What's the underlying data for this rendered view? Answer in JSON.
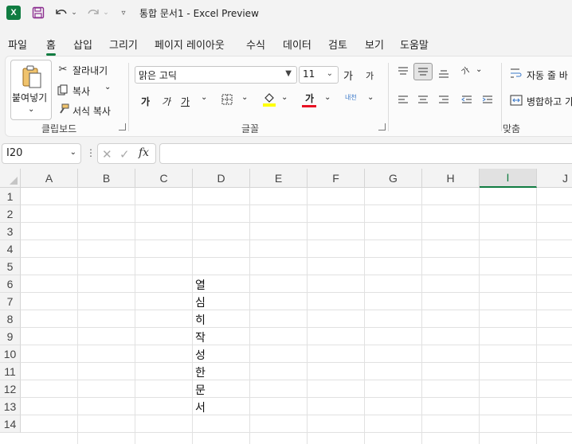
{
  "titlebar": {
    "app_logo": "X",
    "title": "통합 문서1  -  Excel Preview",
    "icons": [
      "save-icon",
      "undo-icon",
      "redo-icon",
      "customize-qat-icon"
    ]
  },
  "menu": {
    "tabs": [
      "파일",
      "홈",
      "삽입",
      "그리기",
      "페이지 레이아웃",
      "수식",
      "데이터",
      "검토",
      "보기",
      "도움말"
    ],
    "active": "홈"
  },
  "ribbon": {
    "clipboard": {
      "paste_label": "붙여넣기",
      "cut_label": "잘라내기",
      "copy_label": "복사",
      "format_painter_label": "서식 복사",
      "group_label": "클립보드"
    },
    "font": {
      "font_name": "맑은 고딕",
      "font_size": "11",
      "grow_label": "가",
      "shrink_label": "가",
      "bold_label": "가",
      "italic_label": "가",
      "underline_label": "가",
      "font_color_label": "가",
      "phonetic_label": "내천",
      "group_label": "글꼴",
      "fill_color": "#ffff00",
      "font_color": "#e81123"
    },
    "alignment": {
      "wrap_label": "자동 줄 바",
      "merge_label": "병합하고 가",
      "orientation_label": "가",
      "group_label": "맞춤"
    }
  },
  "formulabar": {
    "namebox": "I20",
    "fx": "fx",
    "formula": ""
  },
  "grid": {
    "columns": [
      "A",
      "B",
      "C",
      "D",
      "E",
      "F",
      "G",
      "H",
      "I",
      "J"
    ],
    "selected_column": "I",
    "rows": [
      "1",
      "2",
      "3",
      "4",
      "5",
      "6",
      "7",
      "8",
      "9",
      "10",
      "11",
      "12",
      "13",
      "14"
    ],
    "cells_D": [
      "",
      "",
      "",
      "",
      "",
      "열",
      "심",
      "히",
      "작",
      "성",
      "한",
      "문",
      "서",
      ""
    ]
  }
}
